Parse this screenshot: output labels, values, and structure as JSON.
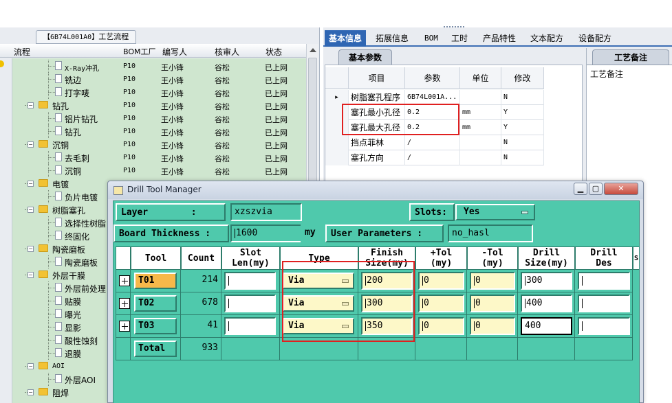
{
  "left_panel": {
    "title_id": "【6B74L001A0】",
    "title_text": "工艺流程",
    "columns": [
      "流程",
      "BOM工厂",
      "编写人",
      "核审人",
      "状态"
    ],
    "rows": [
      {
        "indent": 3,
        "kind": "doc",
        "name": "X-Ray冲孔",
        "mono": true,
        "bom": "P10",
        "writer": "王小锋",
        "reviewer": "谷松",
        "status": "已上网"
      },
      {
        "indent": 3,
        "kind": "doc",
        "name": "铣边",
        "bom": "P10",
        "writer": "王小锋",
        "reviewer": "谷松",
        "status": "已上网"
      },
      {
        "indent": 3,
        "kind": "doc",
        "name": "打字唛",
        "bom": "P10",
        "writer": "王小锋",
        "reviewer": "谷松",
        "status": "已上网"
      },
      {
        "indent": 2,
        "kind": "folder",
        "name": "钻孔",
        "bom": "P10",
        "writer": "王小锋",
        "reviewer": "谷松",
        "status": "已上网"
      },
      {
        "indent": 3,
        "kind": "doc",
        "name": "铝片钻孔",
        "bom": "P10",
        "writer": "王小锋",
        "reviewer": "谷松",
        "status": "已上网"
      },
      {
        "indent": 3,
        "kind": "doc",
        "name": "钻孔",
        "bom": "P10",
        "writer": "王小锋",
        "reviewer": "谷松",
        "status": "已上网"
      },
      {
        "indent": 2,
        "kind": "folder",
        "name": "沉铜",
        "bom": "P10",
        "writer": "王小锋",
        "reviewer": "谷松",
        "status": "已上网"
      },
      {
        "indent": 3,
        "kind": "doc",
        "name": "去毛刺",
        "bom": "P10",
        "writer": "王小锋",
        "reviewer": "谷松",
        "status": "已上网"
      },
      {
        "indent": 3,
        "kind": "doc",
        "name": "沉铜",
        "bom": "P10",
        "writer": "王小锋",
        "reviewer": "谷松",
        "status": "已上网"
      },
      {
        "indent": 2,
        "kind": "folder",
        "name": "电镀",
        "bom": "",
        "writer": "",
        "reviewer": "",
        "status": ""
      },
      {
        "indent": 3,
        "kind": "doc",
        "name": "负片电镀",
        "bom": "",
        "writer": "",
        "reviewer": "",
        "status": ""
      },
      {
        "indent": 2,
        "kind": "folder",
        "name": "树脂塞孔",
        "bom": "",
        "writer": "",
        "reviewer": "",
        "status": ""
      },
      {
        "indent": 3,
        "kind": "doc",
        "name": "选择性树脂",
        "bom": "",
        "writer": "",
        "reviewer": "",
        "status": ""
      },
      {
        "indent": 3,
        "kind": "doc",
        "name": "终固化",
        "bom": "",
        "writer": "",
        "reviewer": "",
        "status": ""
      },
      {
        "indent": 2,
        "kind": "folder",
        "name": "陶瓷磨板",
        "bom": "",
        "writer": "",
        "reviewer": "",
        "status": ""
      },
      {
        "indent": 3,
        "kind": "doc",
        "name": "陶瓷磨板",
        "bom": "",
        "writer": "",
        "reviewer": "",
        "status": ""
      },
      {
        "indent": 2,
        "kind": "folder",
        "name": "外层干膜",
        "bom": "",
        "writer": "",
        "reviewer": "",
        "status": ""
      },
      {
        "indent": 3,
        "kind": "doc",
        "name": "外层前处理",
        "bom": "",
        "writer": "",
        "reviewer": "",
        "status": ""
      },
      {
        "indent": 3,
        "kind": "doc",
        "name": "贴膜",
        "bom": "",
        "writer": "",
        "reviewer": "",
        "status": ""
      },
      {
        "indent": 3,
        "kind": "doc",
        "name": "曝光",
        "bom": "",
        "writer": "",
        "reviewer": "",
        "status": ""
      },
      {
        "indent": 3,
        "kind": "doc",
        "name": "显影",
        "bom": "",
        "writer": "",
        "reviewer": "",
        "status": ""
      },
      {
        "indent": 3,
        "kind": "doc",
        "name": "酸性蚀刻",
        "bom": "",
        "writer": "",
        "reviewer": "",
        "status": ""
      },
      {
        "indent": 3,
        "kind": "doc",
        "name": "退膜",
        "bom": "",
        "writer": "",
        "reviewer": "",
        "status": ""
      },
      {
        "indent": 2,
        "kind": "folder",
        "name": "AOI",
        "mono": true,
        "bom": "",
        "writer": "",
        "reviewer": "",
        "status": ""
      },
      {
        "indent": 3,
        "kind": "doc",
        "name": "外层AOI",
        "bom": "",
        "writer": "",
        "reviewer": "",
        "status": ""
      },
      {
        "indent": 2,
        "kind": "folder",
        "name": "阻焊",
        "bom": "",
        "writer": "",
        "reviewer": "",
        "status": ""
      }
    ]
  },
  "right_panel": {
    "tabs": [
      "基本信息",
      "拓展信息",
      "BOM",
      "工时",
      "产品特性",
      "文本配方",
      "设备配方"
    ],
    "active_tab": "基本信息",
    "subtab": "基本参数",
    "grid_headers": [
      "项目",
      "参数",
      "单位",
      "修改"
    ],
    "grid_rows": [
      {
        "item": "树脂塞孔程序",
        "param": "6B74L001A...",
        "unit": "",
        "mod": "N",
        "current": true
      },
      {
        "item": "塞孔最小孔径",
        "param": "0.2",
        "unit": "mm",
        "mod": "Y"
      },
      {
        "item": "塞孔最大孔径",
        "param": "0.2",
        "unit": "mm",
        "mod": "Y"
      },
      {
        "item": "挡点菲林",
        "param": "/",
        "unit": "",
        "mod": "N"
      },
      {
        "item": "塞孔方向",
        "param": "/",
        "unit": "",
        "mod": "N"
      }
    ],
    "notes_tab": "工艺备注",
    "notes_label": "工艺备注"
  },
  "dialog": {
    "title": "Drill Tool Manager",
    "layer_label": "Layer        :",
    "layer_value": "xzszvia",
    "slots_label": "Slots:",
    "slots_value": "Yes",
    "thickness_label": "Board Thickness :",
    "thickness_value": "1600",
    "thickness_unit": "my",
    "user_params_label": "User Parameters :",
    "user_params_value": "no_hasl",
    "headers": {
      "tool": "Tool",
      "count": "Count",
      "slot_len": "Slot\nLen(my)",
      "type": "Type",
      "finish": "Finish\nSize(my)",
      "plus_tol": "+Tol\n(my)",
      "minus_tol": "-Tol\n(my)",
      "drill_size": "Drill\nSize(my)",
      "drill_des": "Drill\nDes",
      "overflow": "S"
    },
    "tools": [
      {
        "name": "T01",
        "count": "214",
        "slot_len": "",
        "type": "Via",
        "finish": "200",
        "plus_tol": "0",
        "minus_tol": "0",
        "drill_size": "300",
        "drill_des": "",
        "selected": true
      },
      {
        "name": "T02",
        "count": "678",
        "slot_len": "",
        "type": "Via",
        "finish": "300",
        "plus_tol": "0",
        "minus_tol": "0",
        "drill_size": "400",
        "drill_des": ""
      },
      {
        "name": "T03",
        "count": "41",
        "slot_len": "",
        "type": "Via",
        "finish": "350",
        "plus_tol": "0",
        "minus_tol": "0",
        "drill_size": "400",
        "drill_des": "",
        "focused_drill": true
      }
    ],
    "total_label": "Total",
    "total_count": "933"
  },
  "colors": {
    "dialog_bg": "#4fc9ac",
    "tree_bg": "#cfe6cf",
    "tab_active": "#2f66b3",
    "highlight_red": "#e02020",
    "selected_tool": "#f7b84a"
  }
}
